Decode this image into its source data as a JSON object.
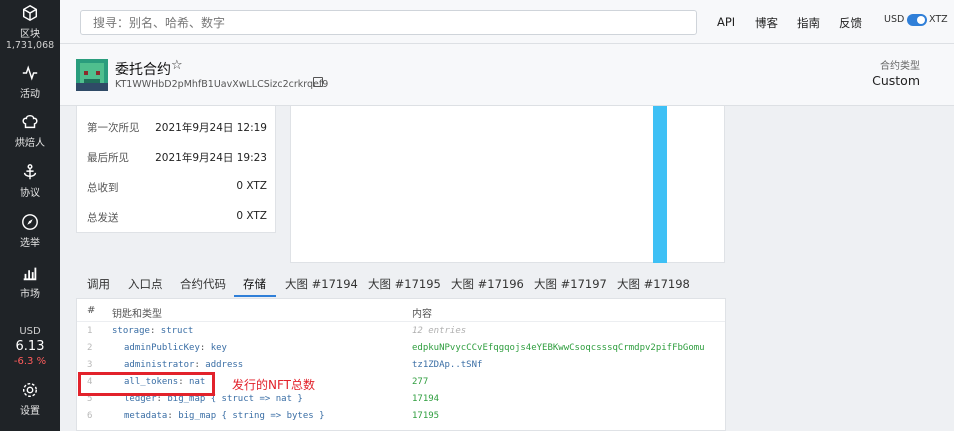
{
  "sidebar": {
    "items": [
      {
        "label": "区块",
        "sub": "1,731,068",
        "icon": "cube-icon"
      },
      {
        "label": "活动",
        "icon": "activity-icon"
      },
      {
        "label": "烘焙人",
        "icon": "chef-hat-icon"
      },
      {
        "label": "协议",
        "icon": "anchor-icon"
      },
      {
        "label": "选举",
        "icon": "compass-icon"
      },
      {
        "label": "市场",
        "icon": "bar-chart-icon"
      },
      {
        "label": "设置",
        "icon": "gear-icon"
      }
    ],
    "price": {
      "currency": "USD",
      "value": "6.13",
      "change": "-6.3 %"
    }
  },
  "topbar": {
    "search_placeholder": "搜寻：别名、哈希、数字",
    "nav": [
      "API",
      "博客",
      "指南",
      "反馈"
    ],
    "currency_left": "USD",
    "currency_right": "XTZ"
  },
  "header": {
    "title": "委托合约",
    "address": "KT1WWHbD2pMhfB1UavXwLLCSizc2crkrqef9",
    "contract_type_label": "合约类型",
    "contract_type_value": "Custom"
  },
  "stats": [
    {
      "label": "第一次所见",
      "value": "2021年9月24日 12:19"
    },
    {
      "label": "最后所见",
      "value": "2021年9月24日 19:23"
    },
    {
      "label": "总收到",
      "value": "0 XTZ"
    },
    {
      "label": "总发送",
      "value": "0 XTZ"
    }
  ],
  "tabs": [
    {
      "label": "调用"
    },
    {
      "label": "入口点"
    },
    {
      "label": "合约代码"
    },
    {
      "label": "存储"
    },
    {
      "label": "大图 #17194"
    },
    {
      "label": "大图 #17195"
    },
    {
      "label": "大图 #17196"
    },
    {
      "label": "大图 #17197"
    },
    {
      "label": "大图 #17198"
    }
  ],
  "storage": {
    "header_num": "#",
    "header_key": "钥匙和类型",
    "header_value": "内容",
    "rows": [
      {
        "num": "1",
        "key": "storage",
        "type": "struct",
        "value": "12 entries"
      },
      {
        "num": "2",
        "key": "adminPublicKey",
        "type": "key",
        "value": "edpkuNPvycCCvEfqgqojs4eYEBKwwCsoqcsssqCrmdpv2pifFbGomu"
      },
      {
        "num": "3",
        "key": "administrator",
        "type": "address",
        "value": "tz1ZDAp..tSNf"
      },
      {
        "num": "4",
        "key": "all_tokens",
        "type": "nat",
        "value": "277"
      },
      {
        "num": "5",
        "key": "ledger",
        "type": "big_map { struct => nat }",
        "value": "17194"
      },
      {
        "num": "6",
        "key": "metadata",
        "type": "big_map { string => bytes }",
        "value": "17195"
      }
    ]
  },
  "annotation": "发行的NFT总数"
}
